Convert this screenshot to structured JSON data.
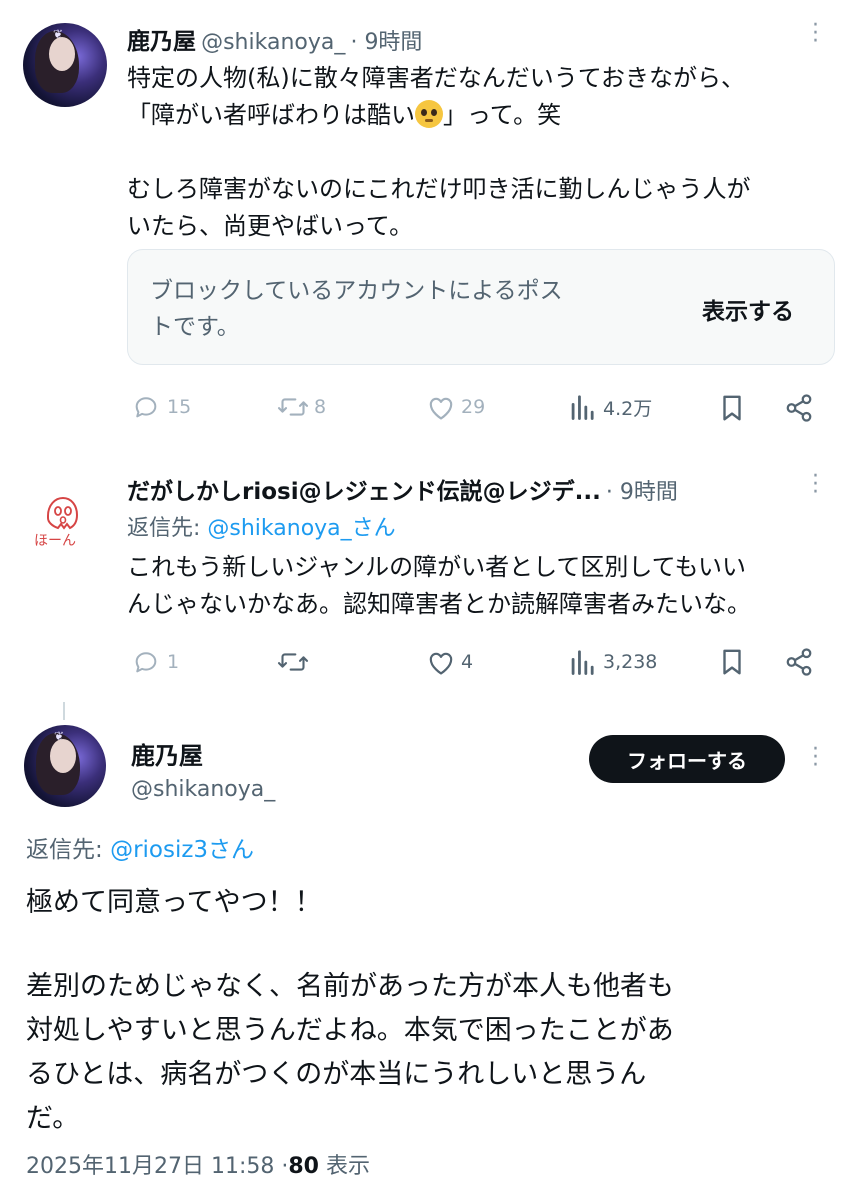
{
  "tweet1": {
    "name": "鹿乃屋",
    "handle": "@shikanoya_",
    "time": "· 9時間",
    "line1": "特定の人物(私)に散々障害者だなんだいうておきながら、",
    "line2a": "「障がい者呼ばわりは酷い",
    "line2b": "」って。笑",
    "line3": "むしろ障害がないのにこれだけ叩き活に勤しんじゃう人が",
    "line4": "いたら、尚更やばいって。",
    "blocked_line1": "ブロックしているアカウントによるポス",
    "blocked_line2": "トです。",
    "show_label": "表示する",
    "replies": "15",
    "reposts": "8",
    "likes": "29",
    "views": "4.2万"
  },
  "tweet2": {
    "name": "だがしかしriosi@レジェンド伝説@レジデ...",
    "time": "· 9時間",
    "reply_prefix": "返信先: ",
    "reply_to": "@shikanoya_さん",
    "line1": "これもう新しいジャンルの障がい者として区別してもいい",
    "line2": "んじゃないかなあ。認知障害者とか読解障害者みたいな。",
    "avatar_text": "ほーん",
    "replies": "1",
    "reposts": "",
    "likes": "4",
    "views": "3,238"
  },
  "tweet3": {
    "name": "鹿乃屋",
    "handle": "@shikanoya_",
    "follow_label": "フォローする",
    "reply_prefix": "返信先: ",
    "reply_to": "@riosiz3さん",
    "para1": "極めて同意ってやつ！！",
    "line2": "差別のためじゃなく、名前があった方が本人も他者も",
    "line3": "対処しやすいと思うんだよね。本気で困ったことがあ",
    "line4": "るひとは、病名がつくのが本当にうれしいと思うん",
    "line5": "だ。",
    "timestamp": "2025年11月27日 11:58",
    "view_sep": "·",
    "view_count": "80",
    "view_label": "表示"
  },
  "colors": {
    "text": "#0f1419",
    "secondary": "#536471",
    "link": "#1d9bf0",
    "button_bg": "#0f1419"
  }
}
